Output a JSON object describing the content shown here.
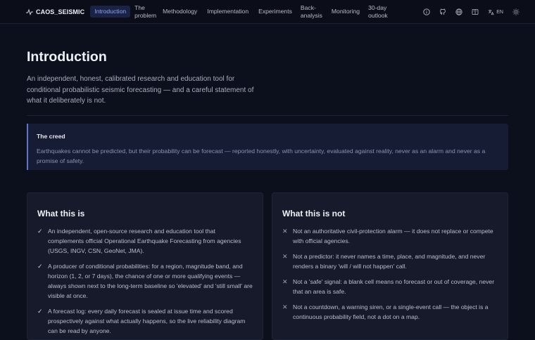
{
  "header": {
    "brand": "CAOS_SEISMIC",
    "nav": [
      {
        "label": "Introduction",
        "active": true
      },
      {
        "label": "The problem",
        "active": false
      },
      {
        "label": "Methodology",
        "active": false
      },
      {
        "label": "Implementation",
        "active": false
      },
      {
        "label": "Experiments",
        "active": false
      },
      {
        "label": "Back-analysis",
        "active": false
      },
      {
        "label": "Monitoring",
        "active": false
      },
      {
        "label": "30-day outlook",
        "active": false
      }
    ],
    "lang": "EN",
    "icons": [
      "info-icon",
      "github-icon",
      "globe-icon",
      "book-icon",
      "translate-icon",
      "sun-icon"
    ]
  },
  "main": {
    "title": "Introduction",
    "intro": "An independent, honest, calibrated research and education tool for conditional probabilistic seismic forecasting — and a careful statement of what it deliberately is not.",
    "creed": {
      "title": "The creed",
      "text": "Earthquakes cannot be predicted, but their probability can be forecast — reported honestly, with uncertainty, evaluated against reality, never as an alarm and never as a promise of safety."
    },
    "is": {
      "title": "What this is",
      "items": [
        "An independent, open-source research and education tool that complements official Operational Earthquake Forecasting from agencies (USGS, INGV, CSN, GeoNet, JMA).",
        "A producer of conditional probabilities: for a region, magnitude band, and horizon (1, 2, or 7 days), the chance of one or more qualifying events — always shown next to the long-term baseline so 'elevated' and 'still small' are visible at once.",
        "A forecast log: every daily forecast is sealed at issue time and scored prospectively against what actually happens, so the live reliability diagram can be read by anyone."
      ]
    },
    "isnot": {
      "title": "What this is not",
      "items": [
        "Not an authoritative civil-protection alarm — it does not replace or compete with official agencies.",
        "Not a predictor: it never names a time, place, and magnitude, and never renders a binary 'will / will not happen' call.",
        "Not a 'safe' signal: a blank cell means no forecast or out of coverage, never that an area is safe.",
        "Not a countdown, a warning siren, or a single-event call — the object is a continuous probability field, not a dot on a map."
      ]
    }
  },
  "colors": {
    "background": "#0c0f1c",
    "accent": "#5f73c8",
    "active_nav": "#8fa6f0",
    "card": "#161a2a"
  }
}
